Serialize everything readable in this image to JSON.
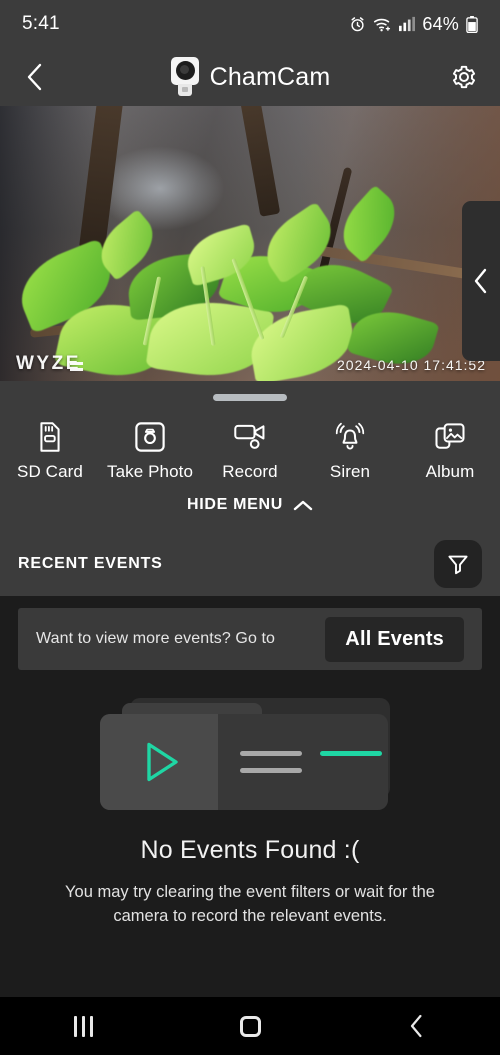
{
  "statusbar": {
    "time": "5:41",
    "battery_percent": "64%",
    "icons": [
      "alarm-icon",
      "wifi-icon",
      "cellular-signal-icon",
      "battery-icon"
    ]
  },
  "titlebar": {
    "back_icon": "back-chevron-icon",
    "device_thumb": "camera-thumbnail-icon",
    "title": "ChamCam",
    "settings_icon": "gear-icon"
  },
  "video": {
    "watermark": "WYZE",
    "timestamp": "2024-04-10 17:41:52",
    "side_tab_icon": "chevron-left-icon"
  },
  "actions": [
    {
      "label": "SD Card",
      "icon": "sd-card-icon"
    },
    {
      "label": "Take Photo",
      "icon": "camera-icon"
    },
    {
      "label": "Record",
      "icon": "video-camera-icon"
    },
    {
      "label": "Siren",
      "icon": "bell-alarm-icon"
    },
    {
      "label": "Album",
      "icon": "photo-album-icon"
    }
  ],
  "hide_menu": {
    "label": "HIDE MENU",
    "icon": "chevron-up-icon"
  },
  "recent_events": {
    "title": "RECENT EVENTS",
    "filter_icon": "filter-funnel-icon"
  },
  "more_events_banner": {
    "text": "Want to view more events? Go to",
    "button_label": "All Events"
  },
  "empty_state": {
    "illustration": "no-events-illustration",
    "play_icon": "play-triangle-icon",
    "title": "No Events Found :(",
    "subtitle": "You may try clearing the event filters or wait for the camera to record the relevant events."
  },
  "navbar": {
    "recents_icon": "recents-icon",
    "home_icon": "home-icon",
    "back_icon": "back-icon"
  },
  "colors": {
    "accent_teal": "#1fd6a4",
    "panel_gray": "#3c3c3c",
    "page_dark": "#1c1c1c",
    "button_dark": "#262626"
  }
}
